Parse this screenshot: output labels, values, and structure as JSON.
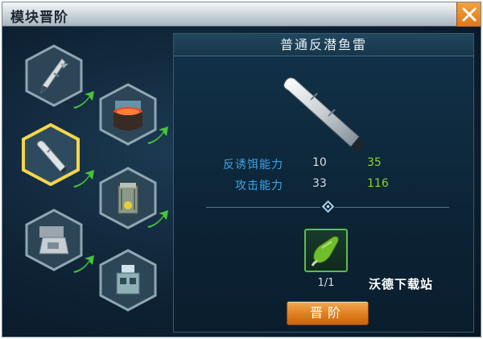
{
  "window": {
    "title": "模块晋阶",
    "close_icon": "close-x-icon"
  },
  "modules": [
    {
      "name": "missile",
      "icon": "missile-icon",
      "selected": false
    },
    {
      "name": "reactor",
      "icon": "reactor-core-icon",
      "selected": false
    },
    {
      "name": "torpedo",
      "icon": "torpedo-icon",
      "selected": true
    },
    {
      "name": "launcher",
      "icon": "launcher-tube-icon",
      "selected": false
    },
    {
      "name": "turret",
      "icon": "naval-turret-icon",
      "selected": false
    },
    {
      "name": "radar",
      "icon": "radar-tower-icon",
      "selected": false
    }
  ],
  "panel": {
    "title": "普通反潜鱼雷",
    "stats": [
      {
        "label": "反诱饵能力",
        "current": "10",
        "next": "35"
      },
      {
        "label": "攻击能力",
        "current": "33",
        "next": "116"
      }
    ],
    "material": {
      "icon": "green-shell-icon",
      "count": "1/1"
    },
    "watermark": "沃德下载站",
    "advance_label": "晋阶"
  },
  "colors": {
    "accent_orange": "#e07f1f",
    "stat_label_blue": "#3fa4e8",
    "next_value_green": "#8fd22a",
    "selected_ring": "#f3d64a"
  }
}
